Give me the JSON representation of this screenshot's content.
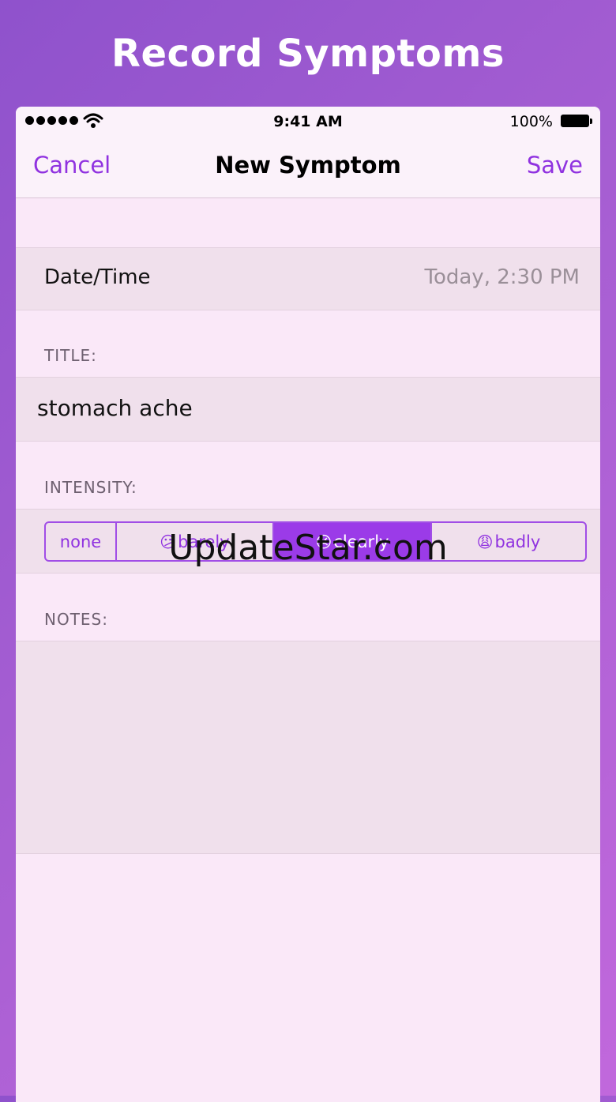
{
  "banner": {
    "title": "Record Symptoms"
  },
  "status_bar": {
    "time": "9:41 AM",
    "battery": "100%"
  },
  "nav": {
    "cancel": "Cancel",
    "title": "New Symptom",
    "save": "Save"
  },
  "date_row": {
    "label": "Date/Time",
    "value": "Today, 2:30 PM"
  },
  "title_section": {
    "header": "TITLE:",
    "value": "stomach ache"
  },
  "intensity_section": {
    "header": "INTENSITY:",
    "options": [
      {
        "emoji": "",
        "label": "none"
      },
      {
        "emoji": "😕",
        "label": "barely"
      },
      {
        "emoji": "😣",
        "label": "clearly"
      },
      {
        "emoji": "😩",
        "label": "badly"
      }
    ],
    "selected": "clearly"
  },
  "notes_section": {
    "header": "NOTES:",
    "value": ""
  },
  "watermark": "UpdateStar.com",
  "colors": {
    "accent": "#9032e0",
    "selected_fill": "#9b3be8",
    "background_start": "#8f52cc",
    "background_end": "#c168dc"
  }
}
